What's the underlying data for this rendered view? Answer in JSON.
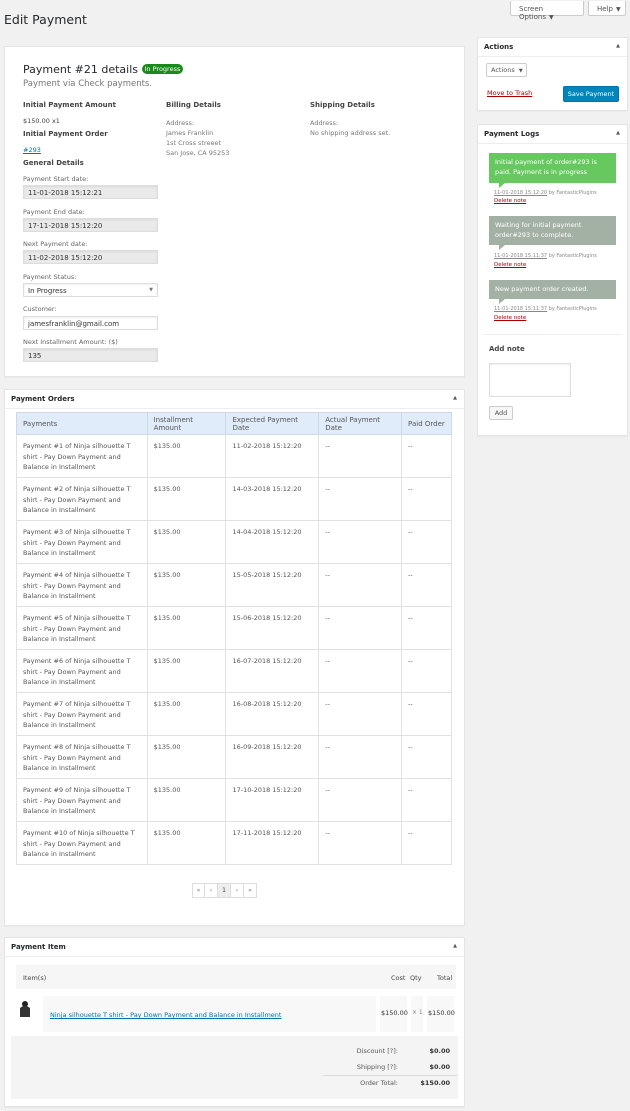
{
  "page": {
    "title": "Edit Payment"
  },
  "top_buttons": {
    "screen_options": "Screen Options",
    "help": "Help"
  },
  "details": {
    "title": "Payment #21 details",
    "status_badge": "In Progress",
    "subtitle": "Payment via Check payments.",
    "initial_amount_label": "Initial Payment Amount",
    "initial_amount_value": "$150.00 x1",
    "initial_order_label": "Initial Payment Order",
    "initial_order_link": "#293",
    "general_label": "General Details",
    "start_label": "Payment Start date:",
    "start_value": "11-01-2018 15:12:21",
    "end_label": "Payment End date:",
    "end_value": "17-11-2018 15:12:20",
    "next_label": "Next Payment date:",
    "next_value": "11-02-2018 15:12:20",
    "status_label": "Payment Status:",
    "status_value": "In Progress",
    "customer_label": "Customer:",
    "customer_value": "jamesfranklin@gmail.com",
    "installment_label": "Next Installment Amount: ($)",
    "installment_value": "135",
    "billing_label": "Billing Details",
    "billing_address_label": "Address:",
    "billing_line1": "James Franklin",
    "billing_line2": "1st Cross streeet",
    "billing_line3": "San Jose, CA 95253",
    "shipping_label": "Shipping Details",
    "shipping_address_label": "Address:",
    "shipping_value": "No shipping address set."
  },
  "orders": {
    "title": "Payment Orders",
    "columns": [
      "Payments",
      "Installment Amount",
      "Expected Payment Date",
      "Actual Payment Date",
      "Paid Order"
    ],
    "rows": [
      [
        "Payment #1 of Ninja silhouette T shirt - Pay Down Payment and Balance in Installment",
        "$135.00",
        "11-02-2018 15:12:20",
        "--",
        "--"
      ],
      [
        "Payment #2 of Ninja silhouette T shirt - Pay Down Payment and Balance in Installment",
        "$135.00",
        "14-03-2018 15:12:20",
        "--",
        "--"
      ],
      [
        "Payment #3 of Ninja silhouette T shirt - Pay Down Payment and Balance in Installment",
        "$135.00",
        "14-04-2018 15:12:20",
        "--",
        "--"
      ],
      [
        "Payment #4 of Ninja silhouette T shirt - Pay Down Payment and Balance in Installment",
        "$135.00",
        "15-05-2018 15:12:20",
        "--",
        "--"
      ],
      [
        "Payment #5 of Ninja silhouette T shirt - Pay Down Payment and Balance in Installment",
        "$135.00",
        "15-06-2018 15:12:20",
        "--",
        "--"
      ],
      [
        "Payment #6 of Ninja silhouette T shirt - Pay Down Payment and Balance in Installment",
        "$135.00",
        "16-07-2018 15:12:20",
        "--",
        "--"
      ],
      [
        "Payment #7 of Ninja silhouette T shirt - Pay Down Payment and Balance in Installment",
        "$135.00",
        "16-08-2018 15:12:20",
        "--",
        "--"
      ],
      [
        "Payment #8 of Ninja silhouette T shirt - Pay Down Payment and Balance in Installment",
        "$135.00",
        "16-09-2018 15:12:20",
        "--",
        "--"
      ],
      [
        "Payment #9 of Ninja silhouette T shirt - Pay Down Payment and Balance in Installment",
        "$135.00",
        "17-10-2018 15:12:20",
        "--",
        "--"
      ],
      [
        "Payment #10 of Ninja silhouette T shirt - Pay Down Payment and Balance in Installment",
        "$135.00",
        "17-11-2018 15:12:20",
        "--",
        "--"
      ]
    ],
    "pager": [
      "«",
      "‹",
      "1",
      "›",
      "»"
    ]
  },
  "item": {
    "title": "Payment Item",
    "col_items": "Item(s)",
    "col_cost": "Cost",
    "col_qty": "Qty",
    "col_total": "Total",
    "product_name": "Ninja silhouette T shirt - Pay Down Payment and Balance in Installment",
    "cost": "$150.00",
    "qty": "× 1",
    "total": "$150.00",
    "discount_label": "Discount [?]:",
    "discount_value": "$0.00",
    "shipping_label": "Shipping [?]:",
    "shipping_value": "$0.00",
    "order_total_label": "Order Total:",
    "order_total_value": "$150.00"
  },
  "actions": {
    "title": "Actions",
    "select_label": "Actions",
    "trash_link": "Move to Trash",
    "save_button": "Save Payment"
  },
  "logs": {
    "title": "Payment Logs",
    "notes": [
      {
        "text": "Initial payment of order#293 is paid. Payment is in progress",
        "date": "11-01-2018 15:12:20",
        "by": "by FantasticPlugins",
        "delete": "Delete note"
      },
      {
        "text": "Waiting for initial payment order#293 to complete.",
        "date": "11-01-2018 15:11:37",
        "by": "by FantasticPlugins",
        "delete": "Delete note"
      },
      {
        "text": "New payment order created.",
        "date": "11-01-2018 15:11:37",
        "by": "by FantasticPlugins",
        "delete": "Delete note"
      }
    ],
    "add_note_label": "Add note",
    "add_button": "Add"
  },
  "colors": {
    "primary": "#0085ba",
    "note_green": "#66c85e",
    "note_gray": "#a3b1a5",
    "badge": "#1a8a1a",
    "link": "#0073aa"
  }
}
